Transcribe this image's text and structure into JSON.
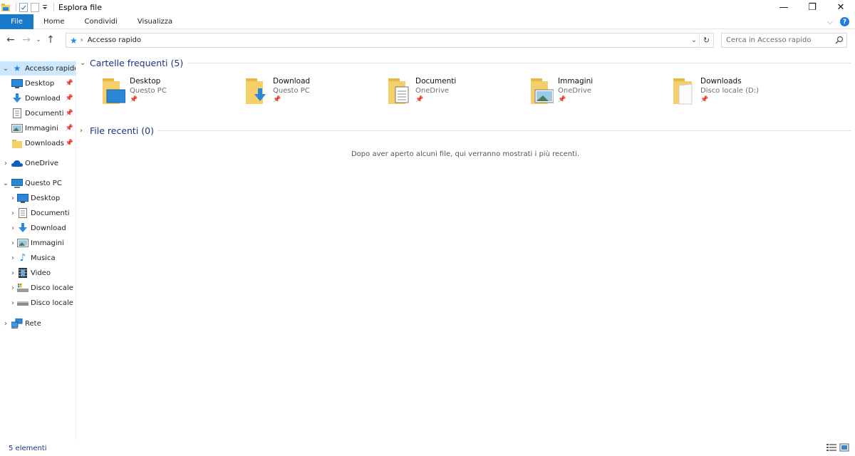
{
  "window": {
    "title": "Esplora file",
    "controls": {
      "minimize": "—",
      "restore": "❐",
      "close": "✕"
    }
  },
  "ribbon": {
    "tabs": [
      "File",
      "Home",
      "Condividi",
      "Visualizza"
    ],
    "file_color": "#1979ca"
  },
  "navigation": {
    "path": [
      "Accesso rapido"
    ]
  },
  "search": {
    "placeholder": "Cerca in Accesso rapido"
  },
  "sidebar": {
    "quick_access": {
      "label": "Accesso rapido",
      "items": [
        {
          "label": "Desktop",
          "icon": "desktop-icon"
        },
        {
          "label": "Download",
          "icon": "download-arrow-icon"
        },
        {
          "label": "Documenti",
          "icon": "document-icon"
        },
        {
          "label": "Immagini",
          "icon": "pictures-icon"
        },
        {
          "label": "Downloads",
          "icon": "folder-icon"
        }
      ]
    },
    "onedrive": {
      "label": "OneDrive",
      "icon": "cloud-icon"
    },
    "this_pc": {
      "label": "Questo PC",
      "items": [
        {
          "label": "Desktop",
          "icon": "desktop-icon"
        },
        {
          "label": "Documenti",
          "icon": "document-icon"
        },
        {
          "label": "Download",
          "icon": "download-arrow-icon"
        },
        {
          "label": "Immagini",
          "icon": "pictures-icon"
        },
        {
          "label": "Musica",
          "icon": "music-note-icon"
        },
        {
          "label": "Video",
          "icon": "video-icon"
        },
        {
          "label": "Disco locale",
          "icon": "os-drive-icon"
        },
        {
          "label": "Disco locale",
          "icon": "drive-icon"
        }
      ]
    },
    "network": {
      "label": "Rete",
      "icon": "network-icon"
    }
  },
  "main": {
    "frequent": {
      "title": "Cartelle frequenti (5)",
      "tiles": [
        {
          "name": "Desktop",
          "location": "Questo PC",
          "icon": "desktop-folder-icon"
        },
        {
          "name": "Download",
          "location": "Questo PC",
          "icon": "download-folder-icon"
        },
        {
          "name": "Documenti",
          "location": "OneDrive",
          "icon": "documents-folder-icon"
        },
        {
          "name": "Immagini",
          "location": "OneDrive",
          "icon": "pictures-folder-icon"
        },
        {
          "name": "Downloads",
          "location": "Disco locale (D:)",
          "icon": "folder-icon"
        }
      ]
    },
    "recent": {
      "title": "File recenti (0)",
      "empty_message": "Dopo aver aperto alcuni file, qui verranno mostrati i più recenti."
    }
  },
  "status": {
    "count": "5 elementi"
  },
  "colors": {
    "accent": "#1979ca",
    "selection": "#cce8ff",
    "group_title": "#1e3287",
    "folder": "#f4cf6a"
  }
}
